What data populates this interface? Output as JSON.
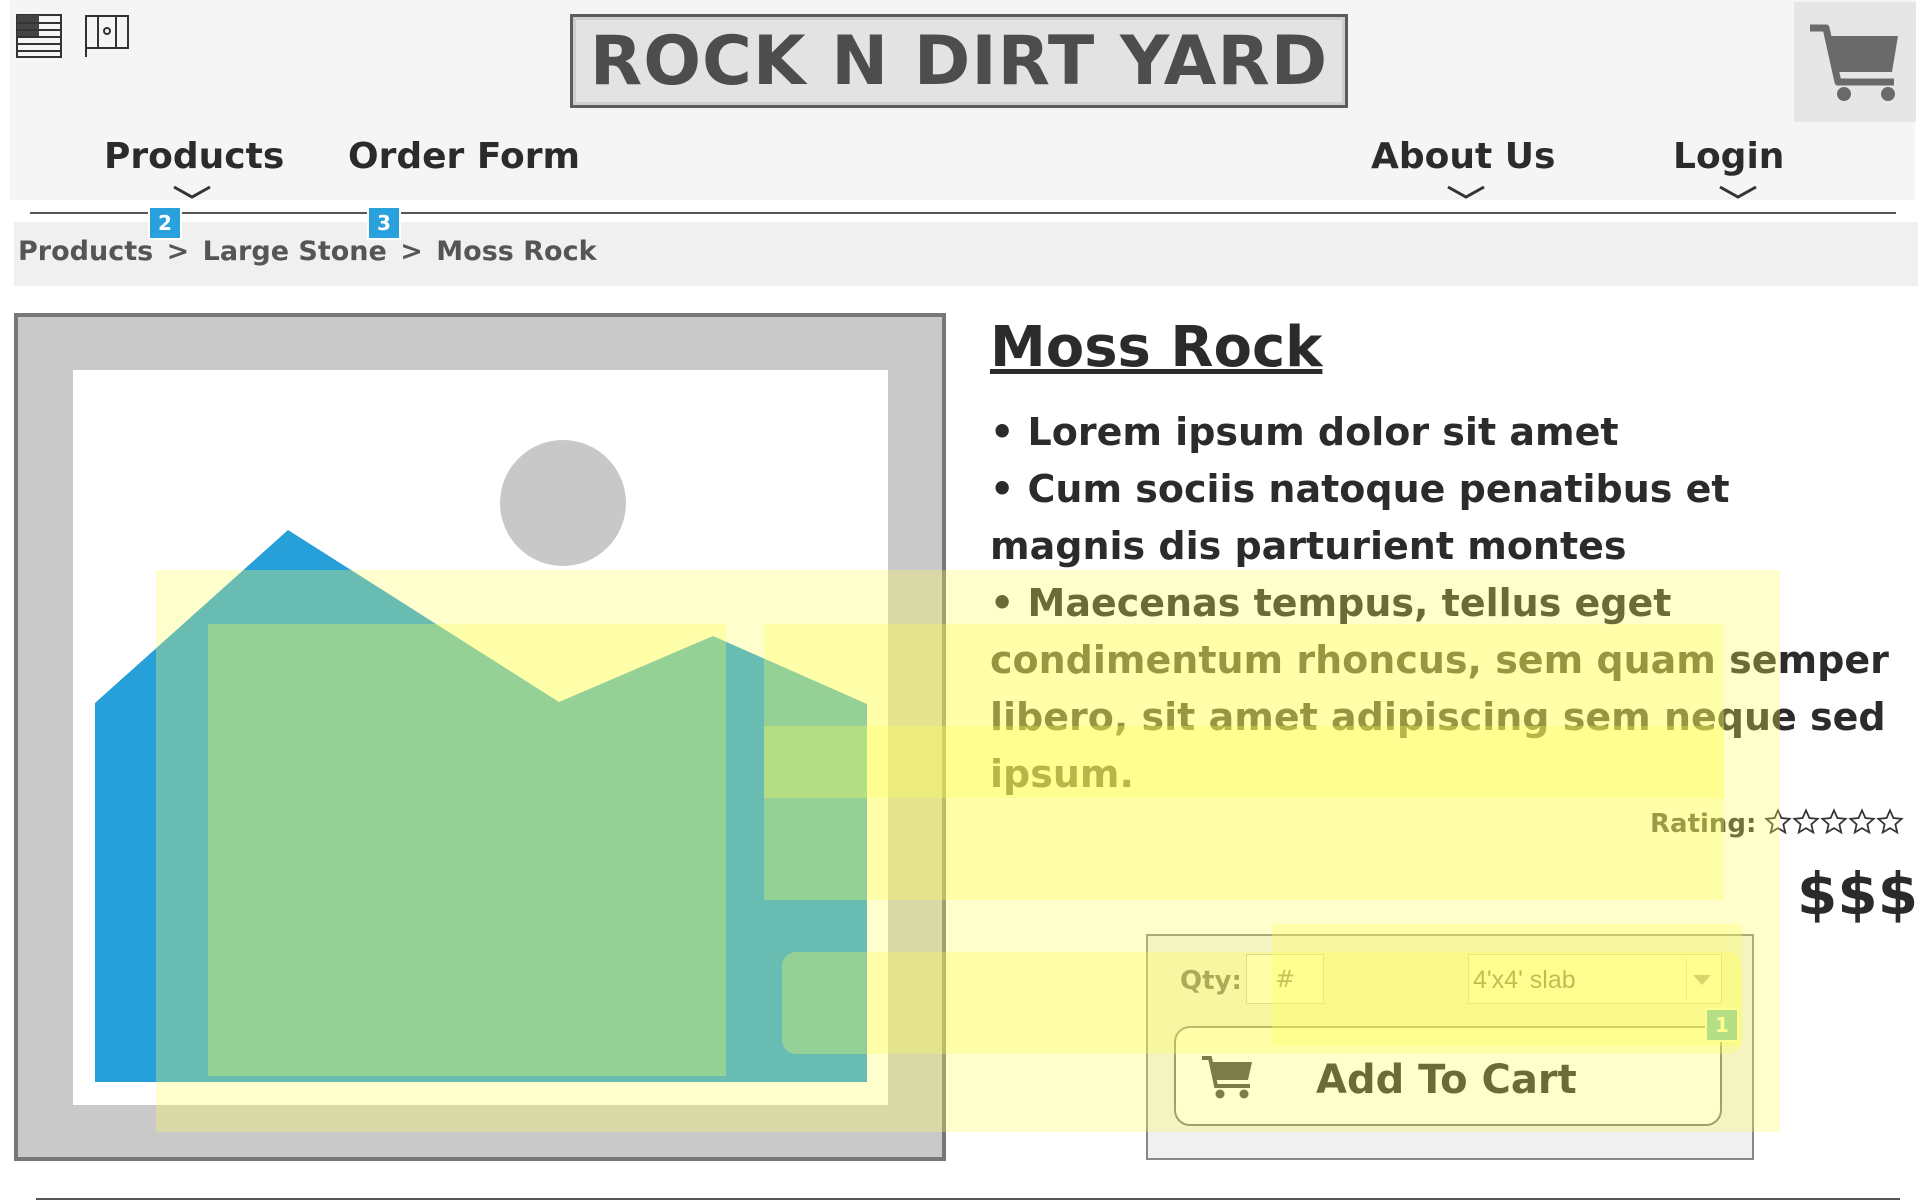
{
  "logo": {
    "text": "ROCK N DIRT YARD"
  },
  "nav": {
    "products": "Products",
    "order_form": "Order Form",
    "about_us": "About Us",
    "login": "Login"
  },
  "callouts": {
    "a": "2",
    "b": "3",
    "c": "1"
  },
  "breadcrumb": {
    "level1": "Products",
    "sep": ">",
    "level2": "Large Stone",
    "level3": "Moss Rock"
  },
  "product": {
    "title": "Moss Rock",
    "bullets": [
      "• Lorem ipsum dolor sit amet",
      "• Cum sociis natoque penatibus et magnis  dis parturient montes",
      "• Maecenas tempus, tellus eget condimentum rhoncus, sem quam semper libero, sit amet adipiscing sem neque sed ipsum."
    ],
    "rating_label": "Rating:",
    "rating_value": 0,
    "rating_max": 5,
    "price": "$$$"
  },
  "purchase": {
    "qty_label": "Qty:",
    "qty_value": "#",
    "size_selected": "4'x4' slab",
    "add_to_cart": "Add To Cart"
  },
  "colors": {
    "accent": "#29a1dd",
    "text": "#2b2b2b",
    "header_bg": "#f5f5f5"
  }
}
